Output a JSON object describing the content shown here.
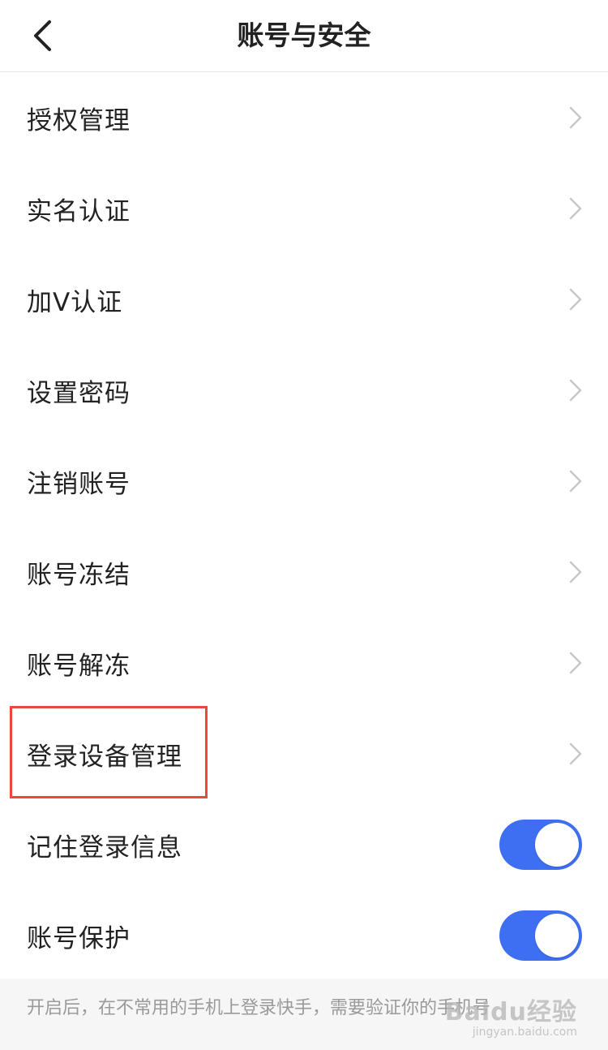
{
  "header": {
    "title": "账号与安全",
    "back_icon": "chevron-left-icon"
  },
  "menu": {
    "items": [
      {
        "label": "授权管理"
      },
      {
        "label": "实名认证"
      },
      {
        "label": "加V认证"
      },
      {
        "label": "设置密码"
      },
      {
        "label": "注销账号"
      },
      {
        "label": "账号冻结"
      },
      {
        "label": "账号解冻"
      },
      {
        "label": "登录设备管理",
        "highlighted": true
      }
    ],
    "chevron_icon": "chevron-right-icon"
  },
  "toggles": [
    {
      "label": "记住登录信息",
      "on": true
    },
    {
      "label": "账号保护",
      "on": true
    }
  ],
  "footer": {
    "note": "开启后，在不常用的手机上登录快手，需要验证你的手机号"
  },
  "watermark": {
    "main": "Baidu经验",
    "sub": "jingyan.baidu.com"
  },
  "colors": {
    "accent": "#3e6ff2",
    "highlight_border": "#e8483f",
    "chevron": "#c7c7cc",
    "footer_bg": "#f6f6f6"
  }
}
